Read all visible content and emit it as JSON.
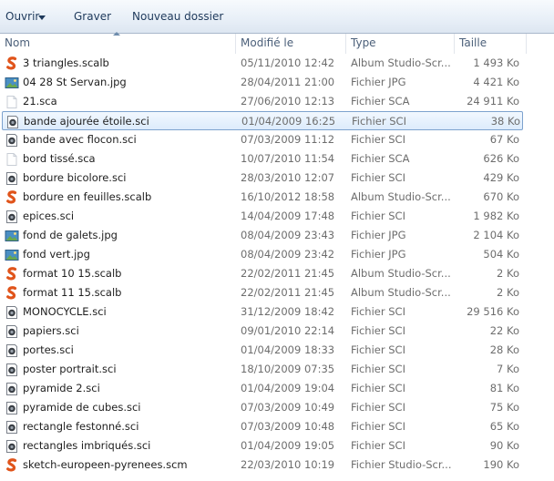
{
  "toolbar": {
    "organize_label": "Ouvrir",
    "burn_label": "Graver",
    "new_folder_label": "Nouveau dossier"
  },
  "columns": {
    "name": "Nom",
    "modified": "Modifié le",
    "type": "Type",
    "size": "Taille"
  },
  "icon_colors": {
    "scalb": "#e0541b",
    "jpg": "#4a8fc4",
    "sci": "#3a3f45",
    "sca": "#c8ced6"
  },
  "files": [
    {
      "name": "3 triangles.scalb",
      "date": "05/11/2010 12:42",
      "type": "Album Studio-Scr...",
      "size": "1 493 Ko",
      "icon": "scalb-icon"
    },
    {
      "name": "04 28 St Servan.jpg",
      "date": "28/04/2011 21:00",
      "type": "Fichier JPG",
      "size": "4 421 Ko",
      "icon": "jpg-icon"
    },
    {
      "name": "21.sca",
      "date": "27/06/2010 12:13",
      "type": "Fichier SCA",
      "size": "24 911 Ko",
      "icon": "sca-icon"
    },
    {
      "name": "bande ajourée étoile.sci",
      "date": "01/04/2009 16:25",
      "type": "Fichier SCI",
      "size": "38 Ko",
      "icon": "sci-icon",
      "selected": true
    },
    {
      "name": "bande avec flocon.sci",
      "date": "07/03/2009 11:12",
      "type": "Fichier SCI",
      "size": "67 Ko",
      "icon": "sci-icon"
    },
    {
      "name": "bord tissé.sca",
      "date": "10/07/2010 11:54",
      "type": "Fichier SCA",
      "size": "626 Ko",
      "icon": "sca-icon"
    },
    {
      "name": "bordure bicolore.sci",
      "date": "28/03/2010 12:07",
      "type": "Fichier SCI",
      "size": "429 Ko",
      "icon": "sci-icon"
    },
    {
      "name": "bordure en feuilles.scalb",
      "date": "16/10/2012 18:58",
      "type": "Album Studio-Scr...",
      "size": "670 Ko",
      "icon": "scalb-icon"
    },
    {
      "name": "epices.sci",
      "date": "14/04/2009 17:48",
      "type": "Fichier SCI",
      "size": "1 982 Ko",
      "icon": "sci-icon"
    },
    {
      "name": "fond de galets.jpg",
      "date": "08/04/2009 23:43",
      "type": "Fichier JPG",
      "size": "2 104 Ko",
      "icon": "jpg-icon"
    },
    {
      "name": "fond vert.jpg",
      "date": "08/04/2009 23:42",
      "type": "Fichier JPG",
      "size": "504 Ko",
      "icon": "jpg-icon"
    },
    {
      "name": "format 10 15.scalb",
      "date": "22/02/2011 21:45",
      "type": "Album Studio-Scr...",
      "size": "2 Ko",
      "icon": "scalb-icon"
    },
    {
      "name": "format 11 15.scalb",
      "date": "22/02/2011 21:45",
      "type": "Album Studio-Scr...",
      "size": "2 Ko",
      "icon": "scalb-icon"
    },
    {
      "name": "MONOCYCLE.sci",
      "date": "31/12/2009 18:42",
      "type": "Fichier SCI",
      "size": "29 516 Ko",
      "icon": "sci-icon"
    },
    {
      "name": "papiers.sci",
      "date": "09/01/2010 22:14",
      "type": "Fichier SCI",
      "size": "22 Ko",
      "icon": "sci-icon"
    },
    {
      "name": "portes.sci",
      "date": "01/04/2009 18:33",
      "type": "Fichier SCI",
      "size": "28 Ko",
      "icon": "sci-icon"
    },
    {
      "name": "poster portrait.sci",
      "date": "18/10/2009 07:35",
      "type": "Fichier SCI",
      "size": "7 Ko",
      "icon": "sci-icon"
    },
    {
      "name": "pyramide 2.sci",
      "date": "01/04/2009 19:04",
      "type": "Fichier SCI",
      "size": "81 Ko",
      "icon": "sci-icon"
    },
    {
      "name": "pyramide de cubes.sci",
      "date": "07/03/2009 10:49",
      "type": "Fichier SCI",
      "size": "75 Ko",
      "icon": "sci-icon"
    },
    {
      "name": "rectangle festonné.sci",
      "date": "07/03/2009 10:48",
      "type": "Fichier SCI",
      "size": "65 Ko",
      "icon": "sci-icon"
    },
    {
      "name": "rectangles imbriqués.sci",
      "date": "01/04/2009 19:05",
      "type": "Fichier SCI",
      "size": "90 Ko",
      "icon": "sci-icon"
    },
    {
      "name": "sketch-europeen-pyrenees.scm",
      "date": "22/03/2010 10:19",
      "type": "Fichier Studio-Scr...",
      "size": "190 Ko",
      "icon": "scalb-icon"
    }
  ]
}
